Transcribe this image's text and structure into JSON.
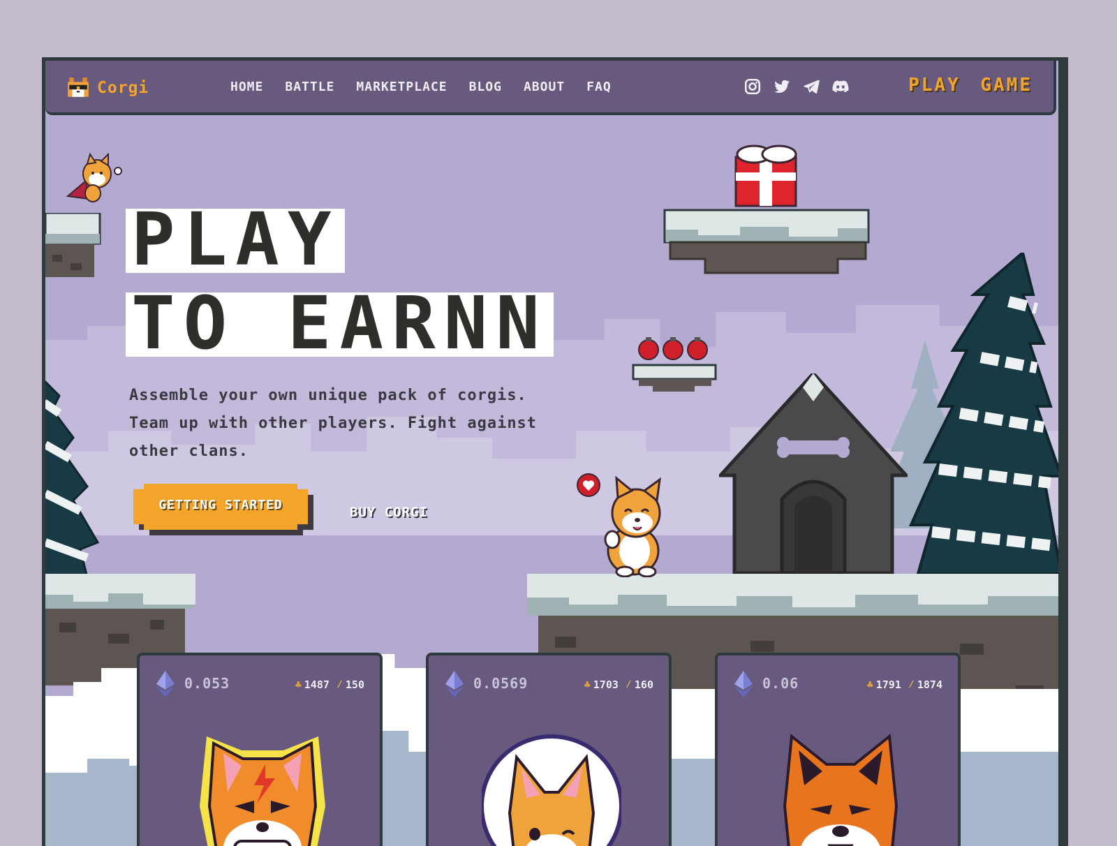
{
  "brand": {
    "name": "Corgi",
    "logo_icon": "corgi-sunglasses-icon"
  },
  "nav": {
    "links": [
      "HOME",
      "BATTLE",
      "MARKETPLACE",
      "BLOG",
      "ABOUT",
      "FAQ"
    ],
    "socials": [
      "instagram-icon",
      "twitter-icon",
      "telegram-icon",
      "discord-icon"
    ],
    "cta": "PLAY GAME"
  },
  "hero": {
    "title_line1": "PLAY",
    "title_line2": "TO EARNN",
    "description": "Assemble your own unique pack of corgis. Team up with other players. Fight against other clans.",
    "primary_cta": "GETTING STARTED",
    "secondary_cta": "BUY CORGI"
  },
  "cards": [
    {
      "price": "0.053",
      "food": "1487",
      "energy": "150"
    },
    {
      "price": "0.0569",
      "food": "1703",
      "energy": "160"
    },
    {
      "price": "0.06",
      "food": "1791",
      "energy": "1874"
    }
  ],
  "colors": {
    "accent": "#f2a42b",
    "nav_bg": "#675a7e",
    "sky": "#b4a9d0",
    "dark": "#2f3a3e"
  }
}
